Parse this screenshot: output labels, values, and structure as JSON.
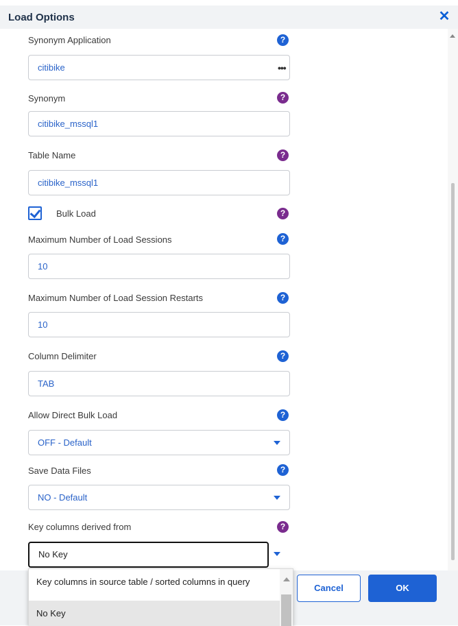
{
  "dialog": {
    "title": "Load Options",
    "close_icon": "close-icon"
  },
  "fields": {
    "synonym_application": {
      "label": "Synonym Application",
      "value": "citibike"
    },
    "synonym": {
      "label": "Synonym",
      "value": "citibike_mssql1"
    },
    "table_name": {
      "label": "Table Name",
      "value": "citibike_mssql1"
    },
    "bulk_load": {
      "label": "Bulk Load",
      "checked": true
    },
    "max_load_sessions": {
      "label": "Maximum Number of Load Sessions",
      "value": "10"
    },
    "max_load_session_restarts": {
      "label": "Maximum Number of Load Session Restarts",
      "value": "10"
    },
    "column_delimiter": {
      "label": "Column Delimiter",
      "value": "TAB"
    },
    "allow_direct_bulk_load": {
      "label": "Allow Direct Bulk Load",
      "value": "OFF - Default"
    },
    "save_data_files": {
      "label": "Save Data Files",
      "value": "NO - Default"
    },
    "key_columns": {
      "label": "Key columns derived from",
      "value": "No Key"
    }
  },
  "dropdown": {
    "options": [
      "Key columns in source table / sorted columns in query",
      "No Key"
    ],
    "selected": "No Key"
  },
  "footer": {
    "cancel_label": "Cancel",
    "ok_label": "OK"
  },
  "help_icon": {
    "glyph": "?",
    "colors": {
      "blue": "#1e62d4",
      "purple": "#7a2c8e"
    }
  },
  "browse_icon": {
    "glyph": "•••"
  }
}
